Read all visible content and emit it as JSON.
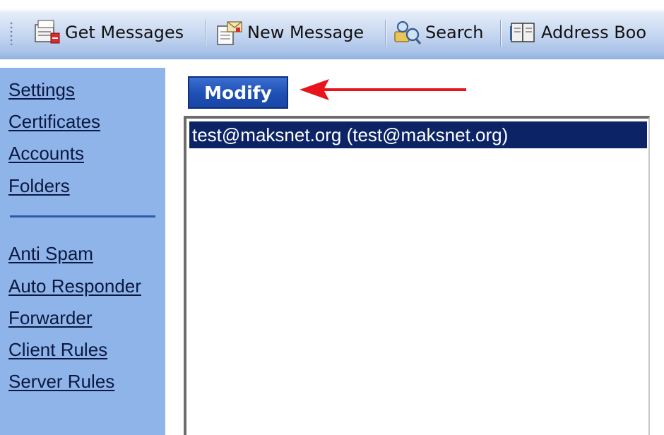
{
  "toolbar": {
    "items": [
      {
        "label": "Get Messages",
        "icon": "get-messages-icon"
      },
      {
        "label": "New Message",
        "icon": "new-message-icon"
      },
      {
        "label": "Search",
        "icon": "search-icon"
      },
      {
        "label": "Address Boo",
        "icon": "address-book-icon"
      }
    ]
  },
  "sidebar": {
    "group1": [
      "Settings",
      "Certificates",
      "Accounts",
      "Folders"
    ],
    "group2": [
      "Anti Spam",
      "Auto Responder",
      "Forwarder",
      "Client Rules",
      "Server Rules"
    ]
  },
  "main": {
    "modify_label": "Modify",
    "accounts": [
      "test@maksnet.org (test@maksnet.org)"
    ],
    "selected_index": 0
  },
  "colors": {
    "sidebar_bg": "#8fb4ea",
    "button_bg": "#1e4fb4",
    "selection_bg": "#0c2466",
    "arrow": "#e8141c"
  }
}
